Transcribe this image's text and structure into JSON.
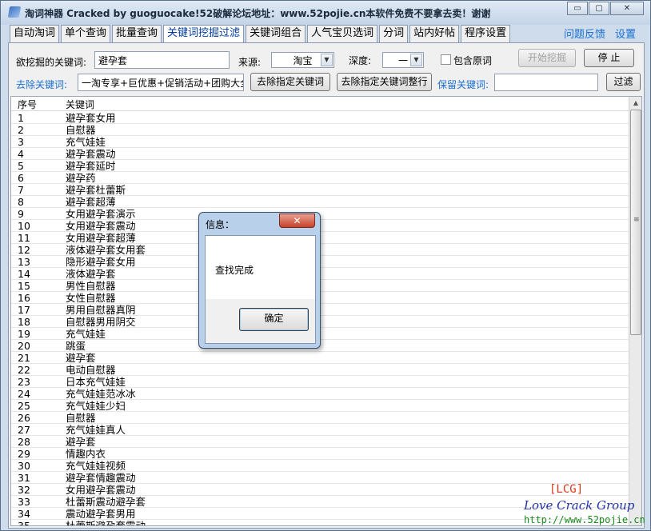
{
  "window": {
    "title": "淘词神器 Cracked by guoguocake!52破解论坛地址：www.52pojie.cn本软件免费不要拿去卖！谢谢",
    "minimize": "▭",
    "maximize": "▢",
    "close": "✕"
  },
  "tabs": [
    {
      "label": "自动淘词",
      "active": false
    },
    {
      "label": "单个查询",
      "active": false
    },
    {
      "label": "批量查询",
      "active": false
    },
    {
      "label": "关键词挖掘过滤",
      "active": true
    },
    {
      "label": "关键词组合",
      "active": false
    },
    {
      "label": "人气宝贝选词",
      "active": false
    },
    {
      "label": "分词",
      "active": false
    },
    {
      "label": "站内好帖",
      "active": false
    },
    {
      "label": "程序设置",
      "active": false
    }
  ],
  "links": {
    "feedback": "问题反馈",
    "settings": "设置"
  },
  "form": {
    "keyword_label": "欲挖掘的关键词:",
    "keyword_value": "避孕套",
    "source_label": "来源:",
    "source_value": "淘宝",
    "depth_label": "深度:",
    "depth_value": "一",
    "include_original_label": "包含原词",
    "start_button": "开始挖掘",
    "stop_button": "停 止",
    "remove_label": "去除关键词:",
    "remove_value": "一淘专享+巨优惠+促销活动+团购大全+",
    "remove_specified_button": "去除指定关键词",
    "remove_rows_button": "去除指定关键词整行",
    "keep_label": "保留关键词:",
    "keep_value": "",
    "filter_button": "过滤"
  },
  "list": {
    "headers": {
      "no": "序号",
      "keyword": "关键词"
    },
    "rows": [
      {
        "no": "1",
        "keyword": "避孕套女用"
      },
      {
        "no": "2",
        "keyword": "自慰器"
      },
      {
        "no": "3",
        "keyword": "充气娃娃"
      },
      {
        "no": "4",
        "keyword": "避孕套震动"
      },
      {
        "no": "5",
        "keyword": "避孕套延时"
      },
      {
        "no": "6",
        "keyword": "避孕药"
      },
      {
        "no": "7",
        "keyword": "避孕套杜蕾斯"
      },
      {
        "no": "8",
        "keyword": "避孕套超薄"
      },
      {
        "no": "9",
        "keyword": "女用避孕套演示"
      },
      {
        "no": "10",
        "keyword": "女用避孕套震动"
      },
      {
        "no": "11",
        "keyword": "女用避孕套超薄"
      },
      {
        "no": "12",
        "keyword": "液体避孕套女用套"
      },
      {
        "no": "13",
        "keyword": "隐形避孕套女用"
      },
      {
        "no": "14",
        "keyword": "液体避孕套"
      },
      {
        "no": "15",
        "keyword": "男性自慰器"
      },
      {
        "no": "16",
        "keyword": "女性自慰器"
      },
      {
        "no": "17",
        "keyword": "男用自慰器真阴"
      },
      {
        "no": "18",
        "keyword": "自慰器男用阴交"
      },
      {
        "no": "19",
        "keyword": "充气娃娃"
      },
      {
        "no": "20",
        "keyword": "跳蛋"
      },
      {
        "no": "21",
        "keyword": "避孕套"
      },
      {
        "no": "22",
        "keyword": "电动自慰器"
      },
      {
        "no": "23",
        "keyword": "日本充气娃娃"
      },
      {
        "no": "24",
        "keyword": "充气娃娃范冰冰"
      },
      {
        "no": "25",
        "keyword": "充气娃娃少妇"
      },
      {
        "no": "26",
        "keyword": "自慰器"
      },
      {
        "no": "27",
        "keyword": "充气娃娃真人"
      },
      {
        "no": "28",
        "keyword": "避孕套"
      },
      {
        "no": "29",
        "keyword": "情趣内衣"
      },
      {
        "no": "30",
        "keyword": "充气娃娃视频"
      },
      {
        "no": "31",
        "keyword": "避孕套情趣震动"
      },
      {
        "no": "32",
        "keyword": "女用避孕套震动"
      },
      {
        "no": "33",
        "keyword": "杜蕾斯震动避孕套"
      },
      {
        "no": "34",
        "keyword": "震动避孕套男用"
      },
      {
        "no": "35",
        "keyword": "杜蕾斯避孕套震动"
      }
    ]
  },
  "scrollbar": {
    "up_arrow": "▲",
    "grip": "≡"
  },
  "watermark": {
    "line1": "[LCG]",
    "line2": "Love Crack Group",
    "line3": "http://www.52pojie.cn"
  },
  "dialog": {
    "title": "信息：",
    "close": "✕",
    "message": "查找完成",
    "ok_button": "确定"
  }
}
